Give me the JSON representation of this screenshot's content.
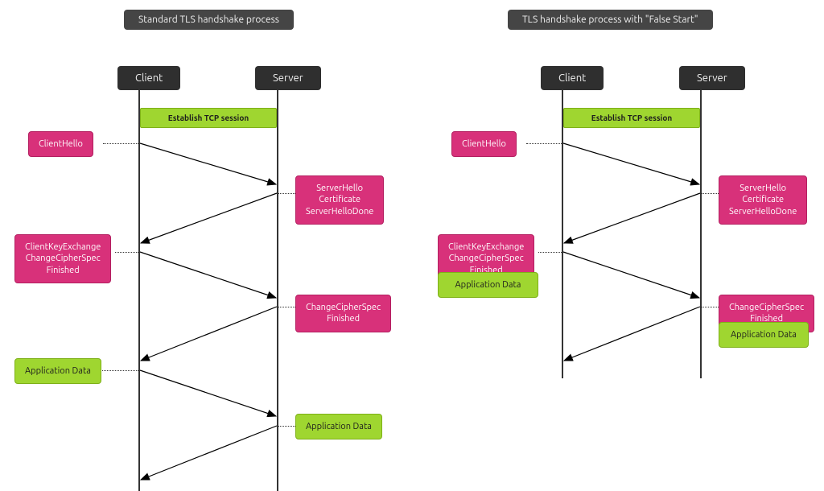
{
  "diagram": {
    "left": {
      "title": "Standard TLS handshake process",
      "client": "Client",
      "server": "Server",
      "tcp": "Establish TCP session",
      "m1": "ClientHello",
      "m2": "ServerHello\nCertificate\nServerHelloDone",
      "m3": "ClientKeyExchange\nChangeCipherSpec\nFinished",
      "m4": "ChangeCipherSpec\nFinished",
      "m5": "Application Data",
      "m6": "Application Data"
    },
    "right": {
      "title": "TLS handshake process with \"False Start\"",
      "client": "Client",
      "server": "Server",
      "tcp": "Establish TCP session",
      "m1": "ClientHello",
      "m2": "ServerHello\nCertificate\nServerHelloDone",
      "m3": "ClientKeyExchange\nChangeCipherSpec\nFinished",
      "m3b": "Application Data",
      "m4": "ChangeCipherSpec\nFinished",
      "m4b": "Application Data"
    }
  }
}
